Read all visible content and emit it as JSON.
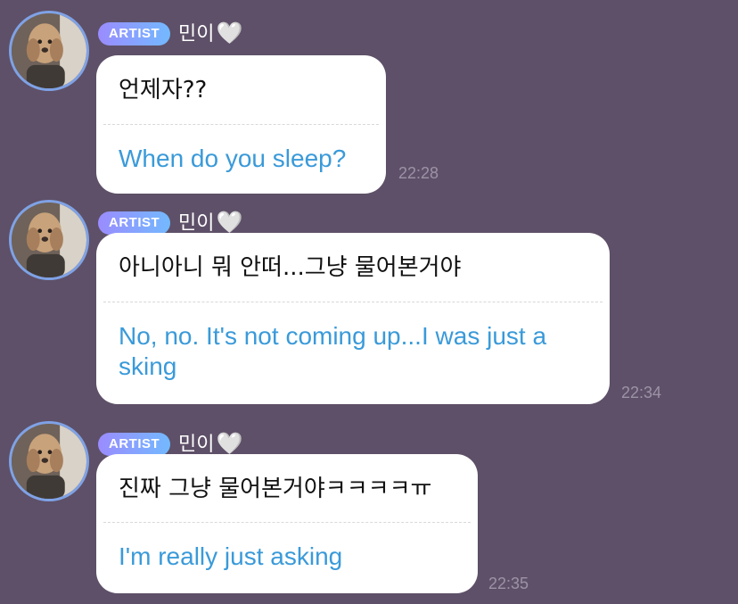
{
  "messages": [
    {
      "badge": "ARTIST",
      "name": "민이",
      "heart": "🤍",
      "original": "언제자??",
      "translation": "When do you sleep?",
      "time": "22:28"
    },
    {
      "badge": "ARTIST",
      "name": "민이",
      "heart": "🤍",
      "original": "아니아니 뭐 안떠...그냥 물어본거야",
      "translation": "No, no. It's not coming up...I was just a sking",
      "time": "22:34"
    },
    {
      "badge": "ARTIST",
      "name": "민이",
      "heart": "🤍",
      "original": "진짜 그냥 물어본거야ㅋㅋㅋㅋㅠ",
      "translation": "I'm really just asking",
      "time": "22:35"
    }
  ],
  "colors": {
    "background": "#5e5068",
    "bubble": "#ffffff",
    "translation_text": "#3a9ad9",
    "badge_gradient_start": "#9a8cff",
    "badge_gradient_end": "#73b9ff",
    "avatar_ring": "#7fa2e6",
    "timestamp": "#9c93a6"
  },
  "icons": {
    "heart": "white-heart-icon",
    "avatar": "artist-avatar"
  }
}
